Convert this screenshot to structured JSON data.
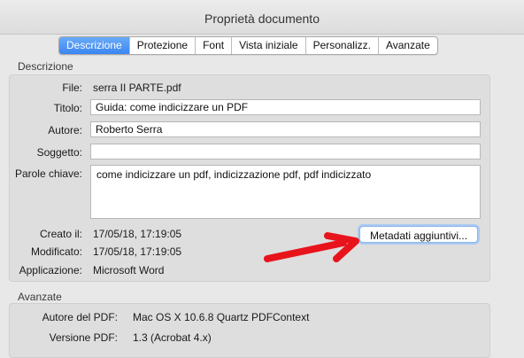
{
  "window": {
    "title": "Proprietà documento"
  },
  "tabs": [
    {
      "label": "Descrizione",
      "active": true
    },
    {
      "label": "Protezione"
    },
    {
      "label": "Font"
    },
    {
      "label": "Vista iniziale"
    },
    {
      "label": "Personalizz."
    },
    {
      "label": "Avanzate"
    }
  ],
  "description": {
    "section_label": "Descrizione",
    "file_label": "File:",
    "file_value": "serra II PARTE.pdf",
    "title_label": "Titolo:",
    "title_value": "Guida: come indicizzare un PDF",
    "author_label": "Autore:",
    "author_value": "Roberto Serra",
    "subject_label": "Soggetto:",
    "subject_value": "",
    "keywords_label": "Parole chiave:",
    "keywords_value": "come indicizzare un pdf, indicizzazione pdf, pdf indicizzato",
    "created_label": "Creato il:",
    "created_value": "17/05/18, 17:19:05",
    "modified_label": "Modificato:",
    "modified_value": "17/05/18, 17:19:05",
    "application_label": "Applicazione:",
    "application_value": "Microsoft Word",
    "metadata_button": "Metadati aggiuntivi..."
  },
  "advanced": {
    "section_label": "Avanzate",
    "pdf_producer_label": "Autore del PDF:",
    "pdf_producer_value": "Mac OS X 10.6.8 Quartz PDFContext",
    "pdf_version_label": "Versione PDF:",
    "pdf_version_value": "1.3 (Acrobat 4.x)"
  },
  "colors": {
    "accent": "#3a86f1",
    "annotation": "#e8141c"
  }
}
